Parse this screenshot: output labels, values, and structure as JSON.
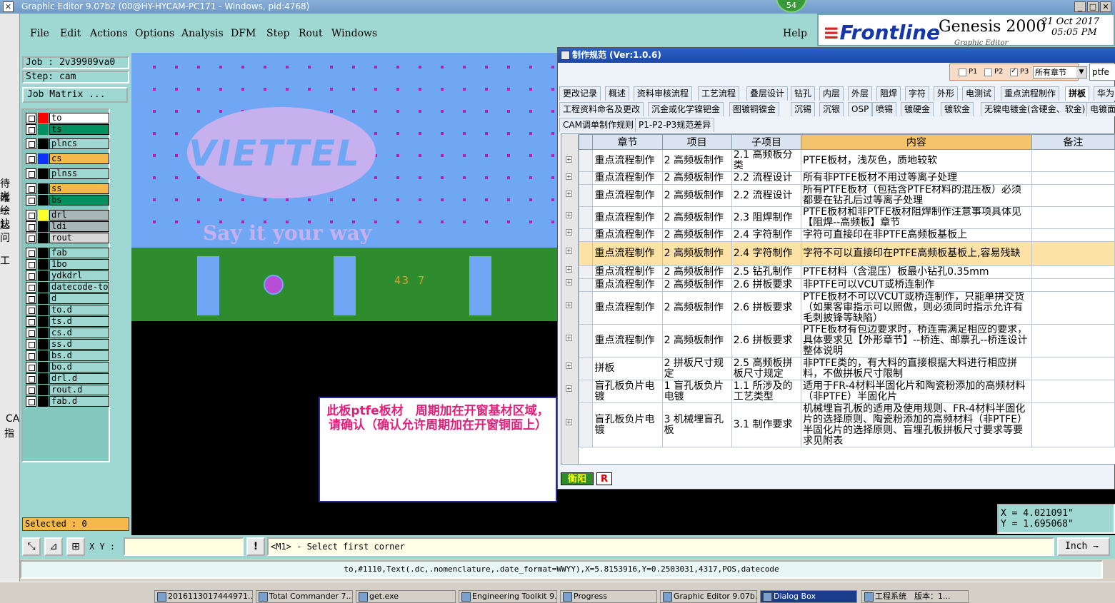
{
  "window": {
    "title": "Graphic Editor 9.07b2 (00@HY-HYCAM-PC171 - Windows, pid:4768)",
    "badge": "54"
  },
  "menu": [
    "File",
    "Edit",
    "Actions",
    "Options",
    "Analysis",
    "DFM",
    "Step",
    "Rout",
    "Windows"
  ],
  "help": "Help",
  "brand": {
    "logo_main": "Frontline",
    "product": "Genesis 2000",
    "date": "21 Oct 2017",
    "time": "05:05 PM",
    "sub": "Graphic Editor"
  },
  "left_strip": [
    "待確",
    "光绘",
    "一起",
    "认问",
    "工",
    "CA",
    "指"
  ],
  "job": {
    "job_line": "Job : 2v39909va0",
    "step_line": "Step: cam",
    "matrix_button": "Job Matrix ..."
  },
  "layers": [
    {
      "name": "to",
      "color": "#ff0000",
      "bg": "#ffffff"
    },
    {
      "name": "ts",
      "color": "#009060",
      "bg": "#009060"
    },
    {
      "name": "plncs",
      "color": "#000000",
      "bg": "#9fd8d3"
    },
    {
      "name": "cs",
      "color": "#1030ff",
      "bg": "#f4b94a"
    },
    {
      "name": "plnss",
      "color": "#000000",
      "bg": "#9fd8d3"
    },
    {
      "name": "ss",
      "color": "#000000",
      "bg": "#f4b94a"
    },
    {
      "name": "bs",
      "color": "#000000",
      "bg": "#009060"
    },
    {
      "name": "drl",
      "color": "#ffff30",
      "bg": "#a8b8b8"
    },
    {
      "name": "ldi",
      "color": "#000000",
      "bg": "#a8b8b8"
    },
    {
      "name": "rout",
      "color": "#000000",
      "bg": "#d8d8d8"
    },
    {
      "name": "fab",
      "color": "#000000",
      "bg": "#9fd8d3"
    },
    {
      "name": "1bo",
      "color": "#000000",
      "bg": "#9fd8d3"
    },
    {
      "name": "ydkdrl",
      "color": "#000000",
      "bg": "#9fd8d3"
    },
    {
      "name": "datecode-to",
      "color": "#000000",
      "bg": "#9fd8d3"
    },
    {
      "name": "d",
      "color": "#000000",
      "bg": "#9fd8d3"
    },
    {
      "name": "to.d",
      "color": "#000000",
      "bg": "#9fd8d3"
    },
    {
      "name": "ts.d",
      "color": "#000000",
      "bg": "#9fd8d3"
    },
    {
      "name": "cs.d",
      "color": "#000000",
      "bg": "#9fd8d3"
    },
    {
      "name": "ss.d",
      "color": "#000000",
      "bg": "#9fd8d3"
    },
    {
      "name": "bs.d",
      "color": "#000000",
      "bg": "#9fd8d3"
    },
    {
      "name": "bo.d",
      "color": "#000000",
      "bg": "#9fd8d3"
    },
    {
      "name": "drl.d",
      "color": "#000000",
      "bg": "#9fd8d3"
    },
    {
      "name": "rout.d",
      "color": "#000000",
      "bg": "#9fd8d3"
    },
    {
      "name": "fab.d",
      "color": "#000000",
      "bg": "#9fd8d3"
    }
  ],
  "selected": "Selected : 0",
  "canvas": {
    "logo_text": "VIETTEL",
    "slogan": "Say it your way",
    "datecode": "43 7"
  },
  "annotation": "此板ptfe板材　周期加在开窗基材区域，请确认（确认允许周期加在开窗铜面上）",
  "dialog": {
    "title": "制作规范 (Ver:1.0.6)",
    "filters": [
      {
        "label": "P1",
        "checked": false
      },
      {
        "label": "P2",
        "checked": false
      },
      {
        "label": "P3",
        "checked": true
      }
    ],
    "chapter_select": "所有章节",
    "search_value": "ptfe",
    "tabs_row1": [
      "更改记录",
      "概述",
      "资料审核流程",
      "工艺流程",
      "叠层设计",
      "钻孔",
      "内层",
      "外层",
      "阻焊",
      "字符",
      "外形",
      "电测试",
      "重点流程制作",
      "拼板",
      "华为"
    ],
    "tabs_row2": [
      "工程资料命名及更改",
      "沉金或化学镍钯金",
      "图镀铜镍金",
      "沉锡",
      "沉银",
      "OSP",
      "喷锡",
      "镀硬金",
      "镀软金",
      "无镍电镀金(含硬金、软金)",
      "电镀面"
    ],
    "tabs_row3": [
      "CAM调单制作规则",
      "P1-P2-P3规范差异"
    ],
    "active_tab": "拼板",
    "columns": [
      "章节",
      "项目",
      "子项目",
      "内容",
      "备注"
    ],
    "rows": [
      {
        "c": [
          "重点流程制作",
          "2 高频板制作",
          "2.1 高频板分类",
          "PTFE板材，浅灰色，质地较软",
          ""
        ]
      },
      {
        "c": [
          "重点流程制作",
          "2 高频板制作",
          "2.2 流程设计",
          "所有非PTFE板材不用过等离子处理",
          ""
        ]
      },
      {
        "c": [
          "重点流程制作",
          "2 高频板制作",
          "2.2 流程设计",
          "所有PTFE板材（包括含PTFE材料的混压板）必须都要在钻孔后过等离子处理",
          ""
        ]
      },
      {
        "c": [
          "重点流程制作",
          "2 高频板制作",
          "2.3 阻焊制作",
          "PTFE板材和非PTFE板材阻焊制作注意事项具体见【阻焊--高频板】章节",
          ""
        ]
      },
      {
        "c": [
          "重点流程制作",
          "2 高频板制作",
          "2.4 字符制作",
          "字符可直接印在非PTFE高频板基板上",
          ""
        ]
      },
      {
        "c": [
          "重点流程制作",
          "2 高频板制作",
          "2.4 字符制作",
          "字符不可以直接印在PTFE高频板基板上,容易残缺",
          ""
        ],
        "sel": true
      },
      {
        "c": [
          "重点流程制作",
          "2 高频板制作",
          "2.5 钻孔制作",
          "PTFE材料（含混压）板最小钻孔0.35mm",
          ""
        ]
      },
      {
        "c": [
          "重点流程制作",
          "2 高频板制作",
          "2.6 拼板要求",
          "非PTFE可以VCUT或桥连制作",
          ""
        ]
      },
      {
        "c": [
          "重点流程制作",
          "2 高频板制作",
          "2.6 拼板要求",
          "PTFE板材不可以VCUT或桥连制作，只能单拼交货（如果客审指示可以照做，则必须同时指示允许有毛刺披锋等缺陷）",
          ""
        ]
      },
      {
        "c": [
          "重点流程制作",
          "2 高频板制作",
          "2.6 拼板要求",
          "PTFE板材有包边要求时，桥连需满足相应的要求，具体要求见【外形章节】--桥连、邮票孔--桥连设计整体说明",
          ""
        ]
      },
      {
        "c": [
          "拼板",
          "2 拼板尺寸规定",
          "2.5 高频板拼板尺寸规定",
          "非PTFE类的，有大料的直接根据大料进行相应拼料，不做拼板尺寸限制",
          ""
        ]
      },
      {
        "c": [
          "盲孔板负片电镀",
          "1 盲孔板负片电镀",
          "1.1 所涉及的工艺类型",
          "适用于FR-4材料半固化片和陶瓷粉添加的高频材料（非PTFE）半固化片",
          ""
        ]
      },
      {
        "c": [
          "盲孔板负片电镀",
          "3 机械埋盲孔板",
          "3.1 制作要求",
          "机械埋盲孔板的适用及使用规则、FR-4材料半固化片的选择原则、陶瓷粉添加的高频材料（非PTFE）半固化片的选择原则、盲埋孔板拼板尺寸要求等要求见附表",
          ""
        ]
      }
    ],
    "bottom_tab": "衡阳",
    "bottom_tab2": "R"
  },
  "readout": {
    "x": "X =  4.021091\"",
    "y": "Y =  1.695068\""
  },
  "toolbar": {
    "xy_label": "X Y :",
    "prompt": "<M1> - Select first corner",
    "unit": "Inch ⇁",
    "warn": "!"
  },
  "command_line": "to,#1110,Text(.dc,.nomenclature,.date_format=WWYY),X=5.8153916,Y=0.2503031,4317,POS,datecode",
  "taskbar": [
    "2016113017444971...",
    "Total Commander 7....",
    "get.exe",
    "Engineering Toolkit 9....",
    "Progress",
    "Graphic Editor 9.07b...",
    "Dialog Box",
    "工程系统　版本：1..."
  ],
  "taskbar_active": "Dialog Box"
}
